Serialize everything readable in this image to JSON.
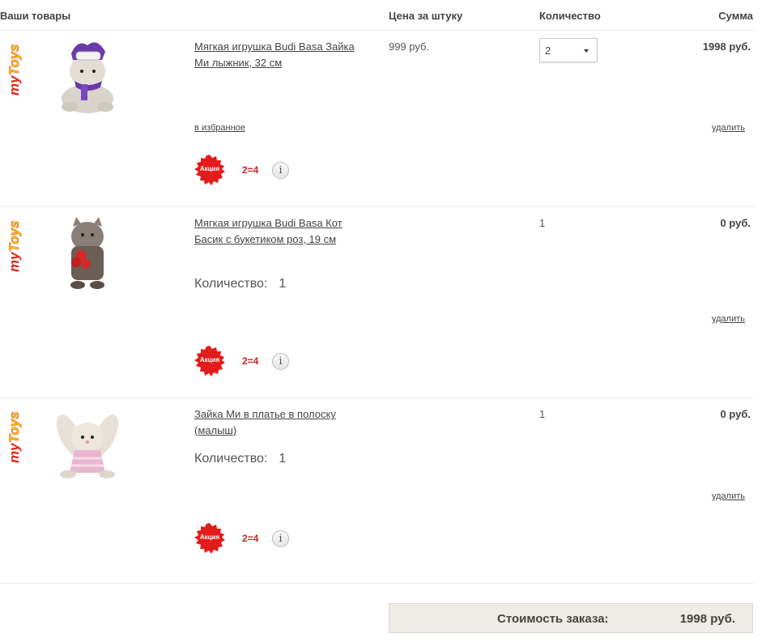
{
  "header": {
    "goods": "Ваши товары",
    "price": "Цена за штуку",
    "quantity": "Количество",
    "sum": "Сумма"
  },
  "brand": {
    "text": "myToys"
  },
  "items": [
    {
      "title": "Мягкая игрушка Budi Basa Зайка Ми лыжник, 32 см",
      "price": "999 руб.",
      "quantity": "2",
      "sum": "1998 руб.",
      "favorite_link": "в избранное",
      "delete_link": "удалить",
      "promo_badge": "Акция",
      "promo_offer": "2=4",
      "info_icon": "i"
    },
    {
      "title": "Мягкая игрушка Budi Basa Кот Басик с букетиком роз, 19 см",
      "quantity": "1",
      "quantity_label": "Количество:",
      "quantity_value": "1",
      "sum": "0 руб.",
      "delete_link": "удалить",
      "promo_badge": "Акция",
      "promo_offer": "2=4",
      "info_icon": "i"
    },
    {
      "title": "Зайка Ми в платье в полоску (малыш)",
      "quantity": "1",
      "quantity_label": "Количество:",
      "quantity_value": "1",
      "sum": "0 руб.",
      "delete_link": "удалить",
      "promo_badge": "Акция",
      "promo_offer": "2=4",
      "info_icon": "i"
    }
  ],
  "total": {
    "label": "Стоимость заказа:",
    "value": "1998 руб."
  },
  "colors": {
    "promo_red": "#d42020",
    "badge_red": "#e31b1b",
    "total_bg": "#efebe7",
    "brand_red": "#e2231a",
    "brand_yellow": "#f7c600"
  }
}
